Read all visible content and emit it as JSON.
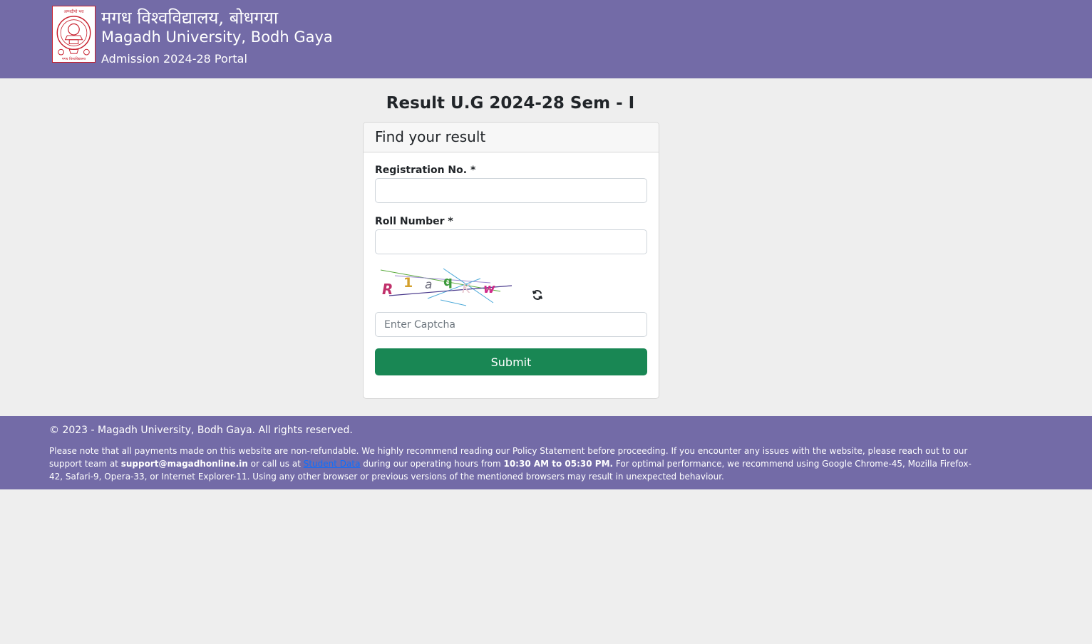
{
  "header": {
    "hindi_title": "मगध विश्वविद्यालय, बोधगया",
    "university_name": "Magadh University, Bodh Gaya",
    "portal_subtitle": "Admission 2024-28 Portal",
    "logo_top_text": "अप्पदीपो भव",
    "logo_bottom_text": "मगध विश्वविद्यालय"
  },
  "page": {
    "heading": "Result U.G 2024-28 Sem - I"
  },
  "form": {
    "card_title": "Find your result",
    "registration_label": "Registration No. *",
    "registration_value": "",
    "roll_label": "Roll Number *",
    "roll_value": "",
    "captcha_text": [
      "R",
      "1",
      "a",
      "q",
      "K",
      "w"
    ],
    "captcha_placeholder": "Enter Captcha",
    "captcha_value": "",
    "submit_label": "Submit"
  },
  "footer": {
    "copyright": "© 2023 - Magadh University, Bodh Gaya. All rights reserved.",
    "notice_part1": "Please note that all payments made on this website are non-refundable. We highly recommend reading our Policy Statement before proceeding. If you encounter any issues with the website, please reach out to our support team at ",
    "support_email": "support@magadhonline.in",
    "notice_part2": " or call us at ",
    "contact_link": "Student Data",
    "notice_part3": " during our operating hours from ",
    "hours": "10:30 AM to 05:30 PM.",
    "notice_part4": " For optimal performance, we recommend using Google Chrome-45, Mozilla Firefox-42, Safari-9, Opera-33, or Internet Explorer-11. Using any other browser or previous versions of the mentioned browsers may result in unexpected behaviour."
  },
  "colors": {
    "header_bg": "#736ba7",
    "page_bg": "#eeeeee",
    "submit_bg": "#198754",
    "logo_red": "#c71f2d",
    "link": "#0d6efd"
  },
  "icons": {
    "logo": "university-emblem-icon",
    "refresh": "refresh-icon"
  }
}
